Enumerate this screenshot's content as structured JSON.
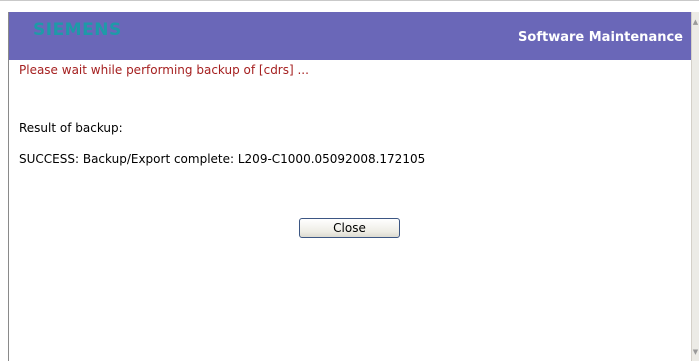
{
  "header": {
    "brand": "SIEMENS",
    "title": "Software Maintenance"
  },
  "content": {
    "status": "Please wait while performing backup of [cdrs] ...",
    "result_label": "Result of backup:",
    "result_message": "SUCCESS: Backup/Export complete: L209-C1000.05092008.172105",
    "close_label": "Close"
  },
  "scrollbar": {
    "up_arrow": "▲",
    "down_arrow": "▼"
  },
  "colors": {
    "header_bg": "#6a67b8",
    "brand": "#1e9aa8",
    "status_text": "#a51f1f"
  }
}
